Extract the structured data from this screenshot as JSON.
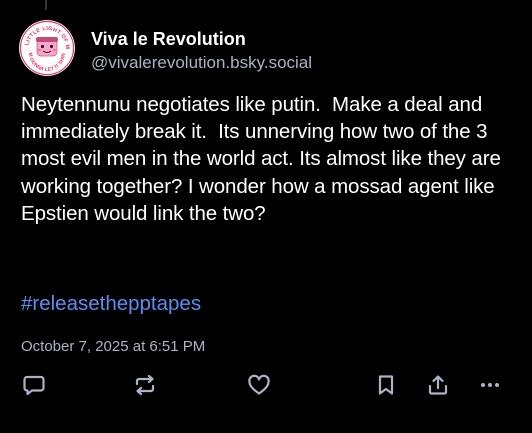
{
  "post": {
    "author": {
      "display_name": "Viva le Revolution",
      "handle": "@vivalerevolution.bsky.social",
      "avatar": {
        "top_text": "THE LITTLE LIGHT OF MINE",
        "bottom_text": "I'M GONNA LET IT SHINE",
        "icon": "cartoon-face-avatar-icon"
      }
    },
    "text": "Neytennunu negotiates like putin.  Make a deal and immediately break it.  Its unnerving how two of the 3 most evil men in the world act. Its almost like they are working together? I wonder how a mossad agent like Epstien would link the two?",
    "hashtag": "#releasethepptapes",
    "timestamp": "October 7, 2025 at 6:51 PM"
  },
  "actions": [
    {
      "name": "reply",
      "icon": "reply-bubble-icon"
    },
    {
      "name": "repost",
      "icon": "repost-arrows-icon"
    },
    {
      "name": "like",
      "icon": "heart-icon"
    },
    {
      "name": "bookmark",
      "icon": "bookmark-icon"
    },
    {
      "name": "share",
      "icon": "share-icon"
    },
    {
      "name": "more",
      "icon": "more-dots-icon"
    }
  ],
  "colors": {
    "background": "#000000",
    "text": "#ffffff",
    "muted": "#a9b4c4",
    "link": "#5a8ef0",
    "icon": "#a9b4c4"
  }
}
